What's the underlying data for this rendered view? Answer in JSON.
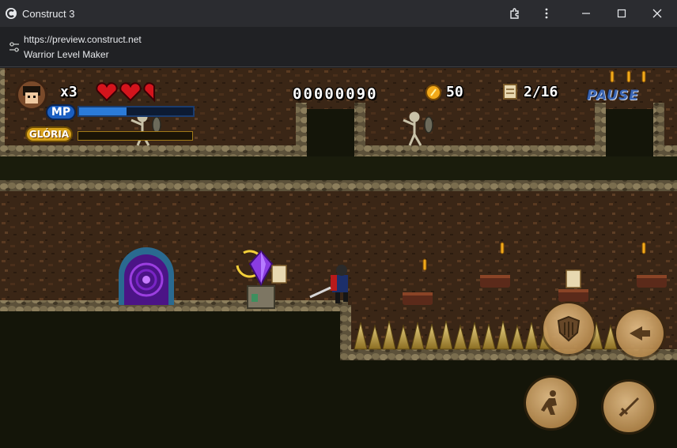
{
  "window": {
    "title": "Construct 3",
    "icons": [
      "construct-logo-icon",
      "extension-icon",
      "more-vertical-icon",
      "minimize-icon",
      "maximize-icon",
      "close-icon"
    ]
  },
  "address": {
    "url": "https://preview.construct.net",
    "page_title": "Warrior Level Maker"
  },
  "hud": {
    "lives": "x3",
    "hearts_filled": 2.5,
    "hearts_total": 3,
    "score": "00000090",
    "coins": "50",
    "scrolls": "2/16",
    "mp_label": "MP",
    "mp_level": 0.42,
    "gloria_label": "GLÓRIA",
    "gloria_level": 0.0,
    "pause_label": "PAUSE"
  },
  "colors": {
    "mp": "#2b7bd8",
    "gloria": "#e6b52a",
    "heart": "#d4141c",
    "coin": "#f2a91a",
    "portal": "#6a1fb0",
    "crystal": "#8a3ce0"
  },
  "controls": [
    "shield-button",
    "dash-button",
    "jump-button",
    "attack-button"
  ]
}
